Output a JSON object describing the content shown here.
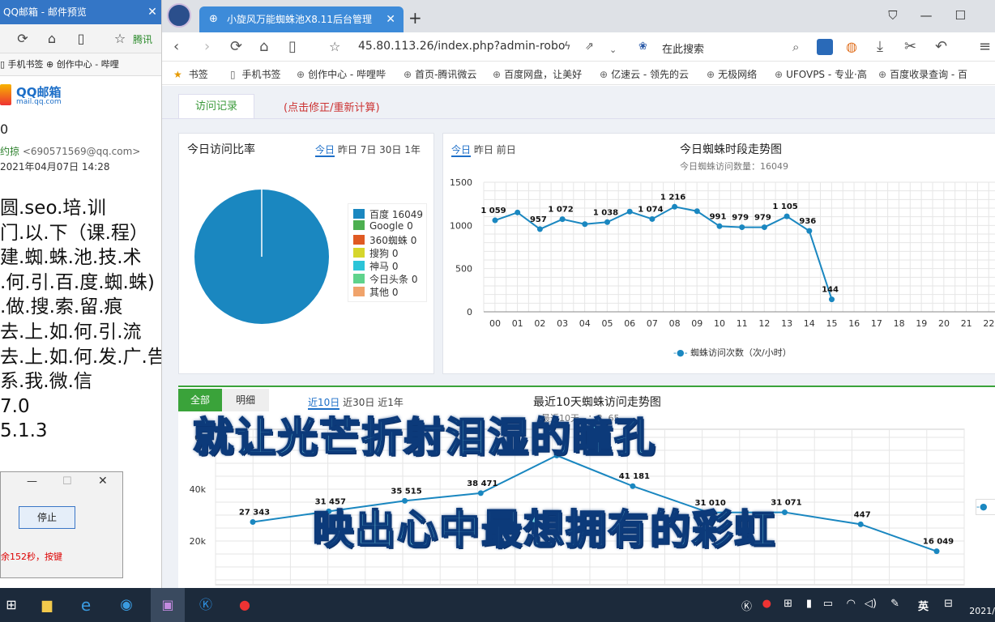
{
  "mail_window": {
    "title": "QQ邮箱 - 邮件预览",
    "close": "✕",
    "bookmarks": "▯  手机书签   ⊕ 创作中心 - 哔哩",
    "logo_text": "QQ邮箱",
    "logo_sub": "mail.qq.com",
    "greeting_fragment": "0",
    "sender_name": "约掠",
    "sender_email": "<690571569@qq.com>",
    "date": "2021年04月07日 14:28",
    "body_lines": [
      "圆.seo.培.训",
      "门.以.下（课.程）",
      "建.蜘.蛛.池.技.术",
      ".何.引.百.度.蜘.蛛)",
      ".做.搜.索.留.痕",
      "去.上.如.何.引.流",
      "去.上.如.何.发.广.告",
      "系.我.微.信",
      "7.0",
      "5.1.3"
    ],
    "dialog_stop_button": "停止",
    "dialog_note": "余152秒，按键",
    "toolbar_tencent": "腾讯"
  },
  "browser": {
    "tab_title": "小旋风万能蜘蛛池X8.11后台管理",
    "url": "45.80.113.26/index.php?admin-robo",
    "search_placeholder": "在此搜索",
    "bookmarks": [
      {
        "label": "书签",
        "icon": "star-icon"
      },
      {
        "label": "手机书签",
        "icon": "phone-icon"
      },
      {
        "label": "创作中心 - 哔哩哔",
        "icon": "globe-icon"
      },
      {
        "label": "首页-腾讯微云",
        "icon": "globe-icon"
      },
      {
        "label": "百度网盘，让美好",
        "icon": "globe-icon"
      },
      {
        "label": "亿速云 - 领先的云",
        "icon": "globe-icon"
      },
      {
        "label": "无极网络",
        "icon": "globe-icon"
      },
      {
        "label": "UFOVPS - 专业·高",
        "icon": "globe-icon"
      },
      {
        "label": "百度收录查询 - 百",
        "icon": "globe-icon"
      }
    ]
  },
  "page": {
    "tab_visits": "访问记录",
    "tab_recalc": "(点击修正/重新计算)",
    "ratio_panel": {
      "title": "今日访问比率",
      "periods": [
        "今日",
        "昨日",
        "7日",
        "30日",
        "1年"
      ],
      "legend": [
        {
          "label": "百度 16049",
          "color": "#1a87c0"
        },
        {
          "label": "Google 0",
          "color": "#4caf50"
        },
        {
          "label": "360蜘蛛 0",
          "color": "#e05a23"
        },
        {
          "label": "搜狗 0",
          "color": "#d6d62c"
        },
        {
          "label": "神马 0",
          "color": "#2bc4d8"
        },
        {
          "label": "今日头条 0",
          "color": "#5fd38c"
        },
        {
          "label": "其他 0",
          "color": "#f0a36b"
        }
      ]
    },
    "hourly_panel": {
      "periods": [
        "今日",
        "昨日",
        "前日"
      ],
      "title": "今日蜘蛛时段走势图",
      "subtitle": "今日蜘蛛访问数量：16049",
      "legend": "蜘蛛访问次数（次/小时）",
      "line_color": "#1a87c0"
    },
    "daily_panel": {
      "btn_all": "全部",
      "btn_detail": "明细",
      "periods": [
        "近10日",
        "近30日",
        "近1年"
      ],
      "title": "最近10天蜘蛛访问走势图",
      "subtitle": "最近10天...：3..65.."
    }
  },
  "lyrics": {
    "line1": "就让光芒折射泪湿的瞳孔",
    "line2": "映出心中最想拥有的彩虹"
  },
  "taskbar": {
    "tray_ime": "英",
    "tray_date": "2021/"
  },
  "chart_data": [
    {
      "type": "pie",
      "title": "今日访问比率",
      "categories": [
        "百度",
        "Google",
        "360蜘蛛",
        "搜狗",
        "神马",
        "今日头条",
        "其他"
      ],
      "values": [
        16049,
        0,
        0,
        0,
        0,
        0,
        0
      ]
    },
    {
      "type": "line",
      "title": "今日蜘蛛时段走势图",
      "subtitle": "今日蜘蛛访问数量：16049",
      "categories": [
        "00",
        "01",
        "02",
        "03",
        "04",
        "05",
        "06",
        "07",
        "08",
        "09",
        "10",
        "11",
        "12",
        "13",
        "14",
        "15",
        "16",
        "17",
        "18",
        "19",
        "20",
        "21",
        "22"
      ],
      "series": [
        {
          "name": "蜘蛛访问次数（次/小时）",
          "values": [
            1059,
            1150,
            957,
            1072,
            1015,
            1038,
            1160,
            1074,
            1216,
            1165,
            991,
            979,
            979,
            1105,
            936,
            144
          ]
        }
      ],
      "data_labels": {
        "0": "1 059",
        "2": "957",
        "3": "1 072",
        "5": "1 038",
        "7": "1 074",
        "8": "1 216",
        "10": "991",
        "11": "979",
        "12": "979",
        "13": "1 105",
        "14": "936",
        "15": "144"
      },
      "yticks": [
        "0",
        "500",
        "1000",
        "1500"
      ],
      "ylim": [
        0,
        1500
      ],
      "grid": true,
      "legend": "bottom-center"
    },
    {
      "type": "line",
      "title": "最近10天蜘蛛访问走势图",
      "series": [
        {
          "name": "",
          "values": [
            27343,
            31457,
            35515,
            38471,
            53000,
            41181,
            31010,
            31071,
            26447,
            16049
          ]
        }
      ],
      "data_labels": {
        "0": "27 343",
        "1": "31 457",
        "2": "35 515",
        "3": "38 471",
        "5": "41 181",
        "6": "31 010",
        "7": "31 071",
        "8": "447",
        "9": "16 049"
      },
      "yticks": [
        "20k",
        "40k",
        "60"
      ],
      "ylim": [
        0,
        60000
      ],
      "grid": true
    }
  ]
}
